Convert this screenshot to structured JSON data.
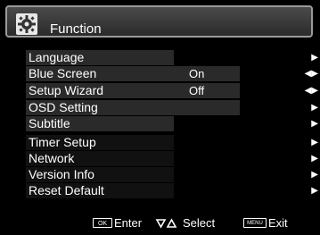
{
  "header": {
    "title": "Function",
    "icon": "gear-icon"
  },
  "menu": {
    "items": [
      {
        "label": "Language",
        "value": "",
        "arrow": "▶"
      },
      {
        "label": "Blue Screen",
        "value": "On",
        "arrow": "◀▶"
      },
      {
        "label": "Setup Wizard",
        "value": "Off",
        "arrow": "◀▶"
      },
      {
        "label": "OSD Setting",
        "value": "",
        "arrow": "▶"
      },
      {
        "label": "Subtitle",
        "value": "",
        "arrow": "▶"
      },
      {
        "label": "Timer Setup",
        "value": "",
        "arrow": "▶"
      },
      {
        "label": "Network",
        "value": "",
        "arrow": "▶"
      },
      {
        "label": "Version Info",
        "value": "",
        "arrow": "▶"
      },
      {
        "label": "Reset Default",
        "value": "",
        "arrow": "▶"
      }
    ]
  },
  "footer": {
    "ok_key": "OK",
    "ok_label": "Enter",
    "nav_label": "Select",
    "menu_key": "MENU",
    "menu_label": "Exit"
  }
}
